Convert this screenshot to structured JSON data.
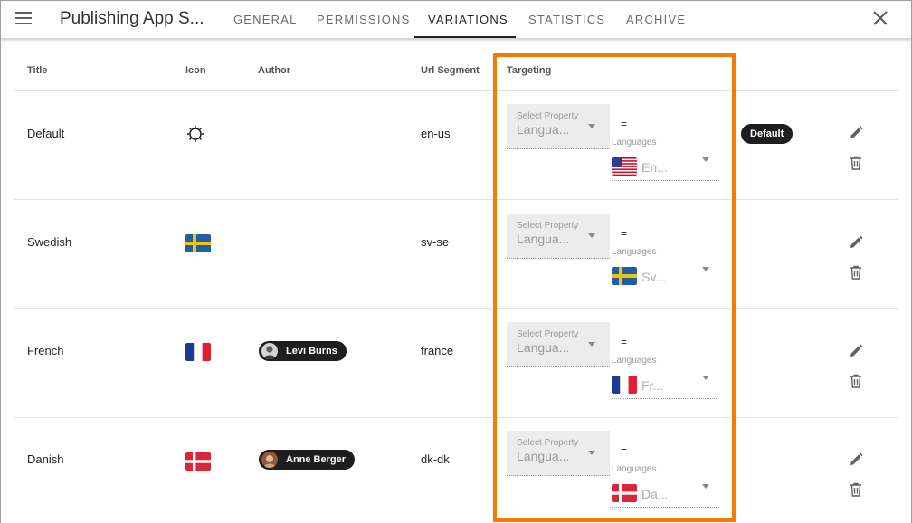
{
  "app": {
    "title": "Publishing App S...",
    "tabs": [
      {
        "label": "GENERAL",
        "active": false
      },
      {
        "label": "PERMISSIONS",
        "active": false
      },
      {
        "label": "VARIATIONS",
        "active": true
      },
      {
        "label": "STATISTICS",
        "active": false
      },
      {
        "label": "ARCHIVE",
        "active": false
      }
    ],
    "icons": {
      "menu": "hamburger-menu-icon",
      "close": "close-icon"
    }
  },
  "table": {
    "columns": [
      "Title",
      "Icon",
      "Author",
      "Url Segment",
      "Targeting"
    ],
    "property_label": "Select Property",
    "property_value": "Langua...",
    "operator": "=",
    "languages_label": "Languages",
    "rows": [
      {
        "title": "Default",
        "icon": "sun-icon",
        "author": "",
        "url": "en-us",
        "language_value": "En...",
        "badge": "Default"
      },
      {
        "title": "Swedish",
        "icon": "flag-sweden-icon",
        "author": "",
        "url": "sv-se",
        "language_value": "Sv...",
        "badge": ""
      },
      {
        "title": "French",
        "icon": "flag-france-icon",
        "author": "Levi Burns",
        "url": "france",
        "language_value": "Fr...",
        "badge": ""
      },
      {
        "title": "Danish",
        "icon": "flag-denmark-icon",
        "author": "Anne Berger",
        "url": "dk-dk",
        "language_value": "Da...",
        "badge": ""
      }
    ]
  },
  "colors": {
    "highlight": "#f57c00",
    "chip": "#1e1e1e"
  }
}
